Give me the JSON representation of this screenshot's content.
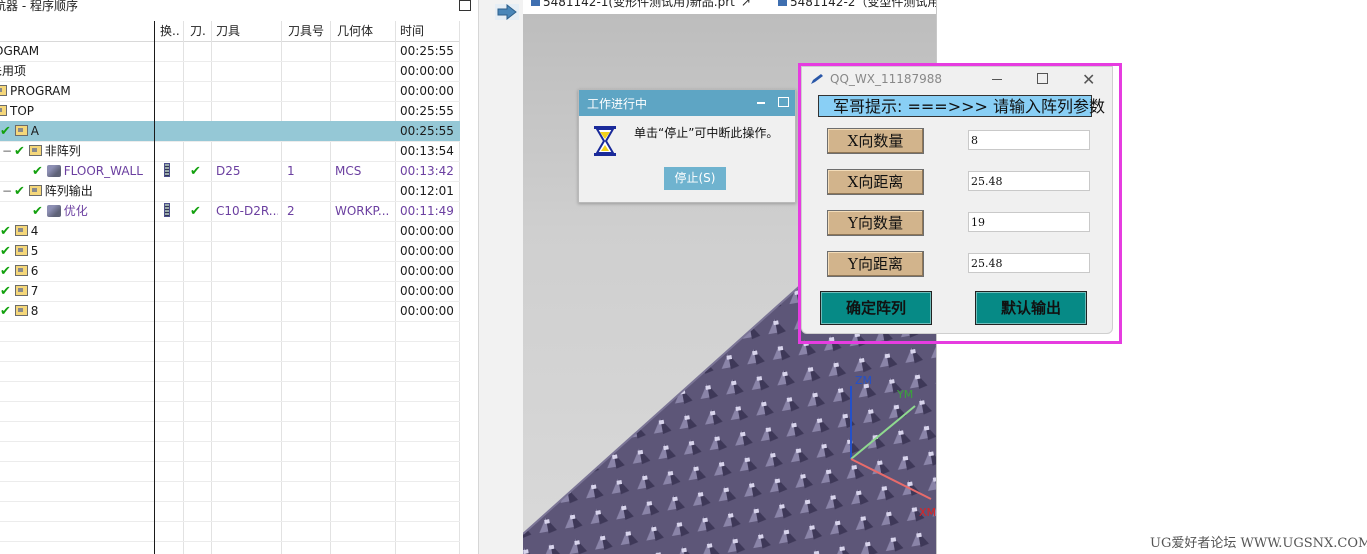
{
  "navigator": {
    "title": "航器 - 程序顺序",
    "columns": [
      "换..",
      "刀.",
      "刀具",
      "刀具号",
      "几何体",
      "时间"
    ],
    "rows": [
      {
        "name": "OGRAM",
        "check": "",
        "tool": "",
        "toolno": "",
        "geom": "",
        "time": "00:25:55"
      },
      {
        "name": "未用项",
        "check": "",
        "tool": "",
        "toolno": "",
        "geom": "",
        "time": "00:00:00"
      },
      {
        "name": "PROGRAM",
        "check": "",
        "tool": "",
        "toolno": "",
        "geom": "",
        "time": "00:00:00"
      },
      {
        "name": "TOP",
        "check": "",
        "tool": "",
        "toolno": "",
        "geom": "",
        "time": "00:25:55"
      },
      {
        "name": "A",
        "check": "✔",
        "tool": "",
        "toolno": "",
        "geom": "",
        "time": "00:25:55"
      },
      {
        "name": "非阵列",
        "check": "✔",
        "tool": "",
        "toolno": "",
        "geom": "",
        "time": "00:13:54"
      },
      {
        "name": "FLOOR_WALL",
        "check": "✔",
        "tool": "D25",
        "toolno": "1",
        "geom": "MCS",
        "time": "00:13:42"
      },
      {
        "name": "阵列输出",
        "check": "✔",
        "tool": "",
        "toolno": "",
        "geom": "",
        "time": "00:12:01"
      },
      {
        "name": "优化",
        "check": "✔",
        "tool": "C10-D2R...",
        "toolno": "2",
        "geom": "WORKP...",
        "time": "00:11:49"
      },
      {
        "name": "4",
        "check": "✔",
        "tool": "",
        "toolno": "",
        "geom": "",
        "time": "00:00:00"
      },
      {
        "name": "5",
        "check": "✔",
        "tool": "",
        "toolno": "",
        "geom": "",
        "time": "00:00:00"
      },
      {
        "name": "6",
        "check": "✔",
        "tool": "",
        "toolno": "",
        "geom": "",
        "time": "00:00:00"
      },
      {
        "name": "7",
        "check": "✔",
        "tool": "",
        "toolno": "",
        "geom": "",
        "time": "00:00:00"
      },
      {
        "name": "8",
        "check": "✔",
        "tool": "",
        "toolno": "",
        "geom": "",
        "time": "00:00:00"
      }
    ]
  },
  "tabs": [
    {
      "label": "5481142-1(变形件测试用)新品.prt"
    },
    {
      "label": "5481142-2（变型件测试用"
    }
  ],
  "axes": {
    "z": "ZM",
    "y": "YM",
    "x": "XM"
  },
  "progress_dialog": {
    "title": "工作进行中",
    "message": "单击“停止”可中断此操作。",
    "stop_label": "停止(S)"
  },
  "array_dialog": {
    "title": "QQ_WX_11187988",
    "hint": "军哥提示: ===>>> 请输入阵列参数",
    "fields": [
      {
        "label": "X向数量",
        "value": "8"
      },
      {
        "label": "X向距离",
        "value": "25.48"
      },
      {
        "label": "Y向数量",
        "value": "19"
      },
      {
        "label": "Y向距离",
        "value": "25.48"
      }
    ],
    "confirm_label": "确定阵列",
    "default_label": "默认输出"
  },
  "watermark": "UG爱好者论坛 WWW.UGSNX.COM",
  "colors": {
    "accent": "#e63ce0",
    "selection": "#95c8d6",
    "teal_button": "#068a86",
    "tan_button": "#d2b48c",
    "hint_bg": "#89cff5"
  }
}
